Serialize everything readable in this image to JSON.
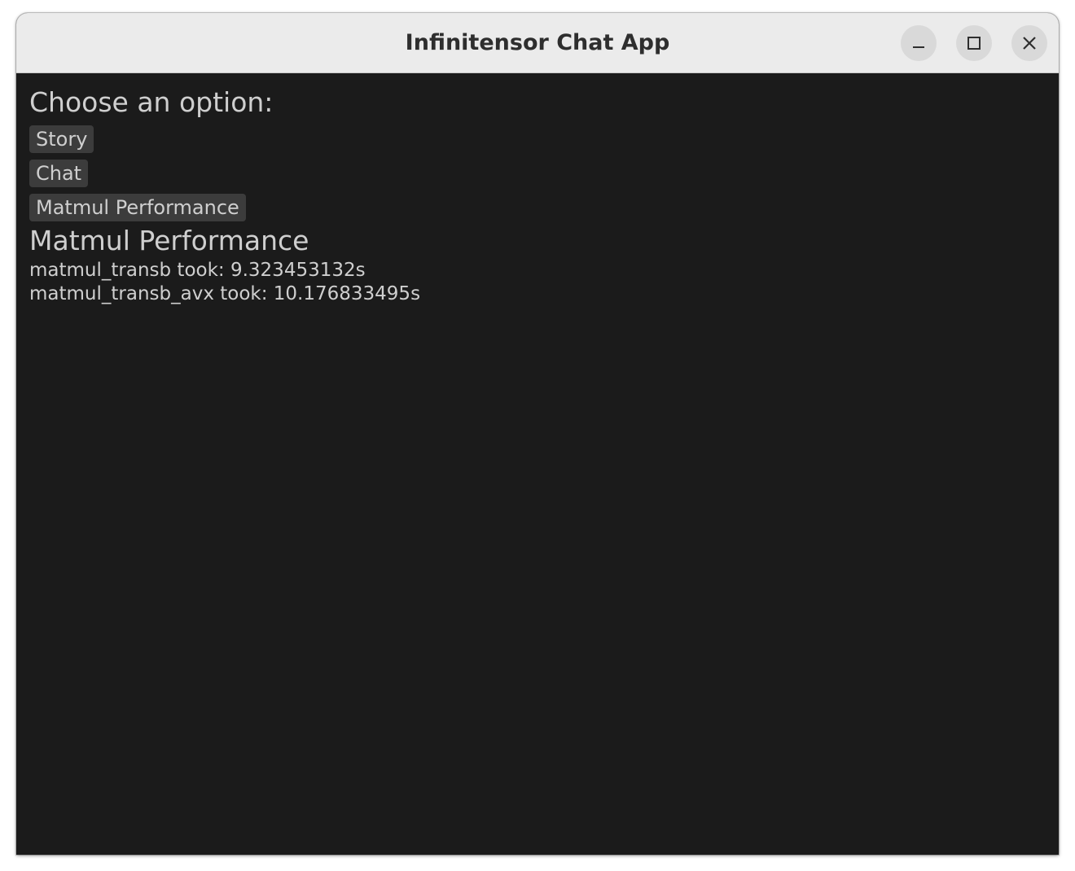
{
  "window": {
    "title": "Infinitensor Chat App"
  },
  "main": {
    "prompt": "Choose an option:",
    "options": [
      {
        "label": "Story"
      },
      {
        "label": "Chat"
      },
      {
        "label": "Matmul Performance"
      }
    ],
    "result": {
      "title": "Matmul Performance",
      "lines": [
        "matmul_transb took: 9.323453132s",
        "matmul_transb_avx took: 10.176833495s"
      ]
    }
  },
  "colors": {
    "background": "#1b1b1b",
    "button": "#3c3c3c",
    "text": "#cfcfcf",
    "titlebar": "#ebebeb"
  },
  "icons": {
    "minimize": "minimize-icon",
    "maximize": "maximize-icon",
    "close": "close-icon"
  }
}
